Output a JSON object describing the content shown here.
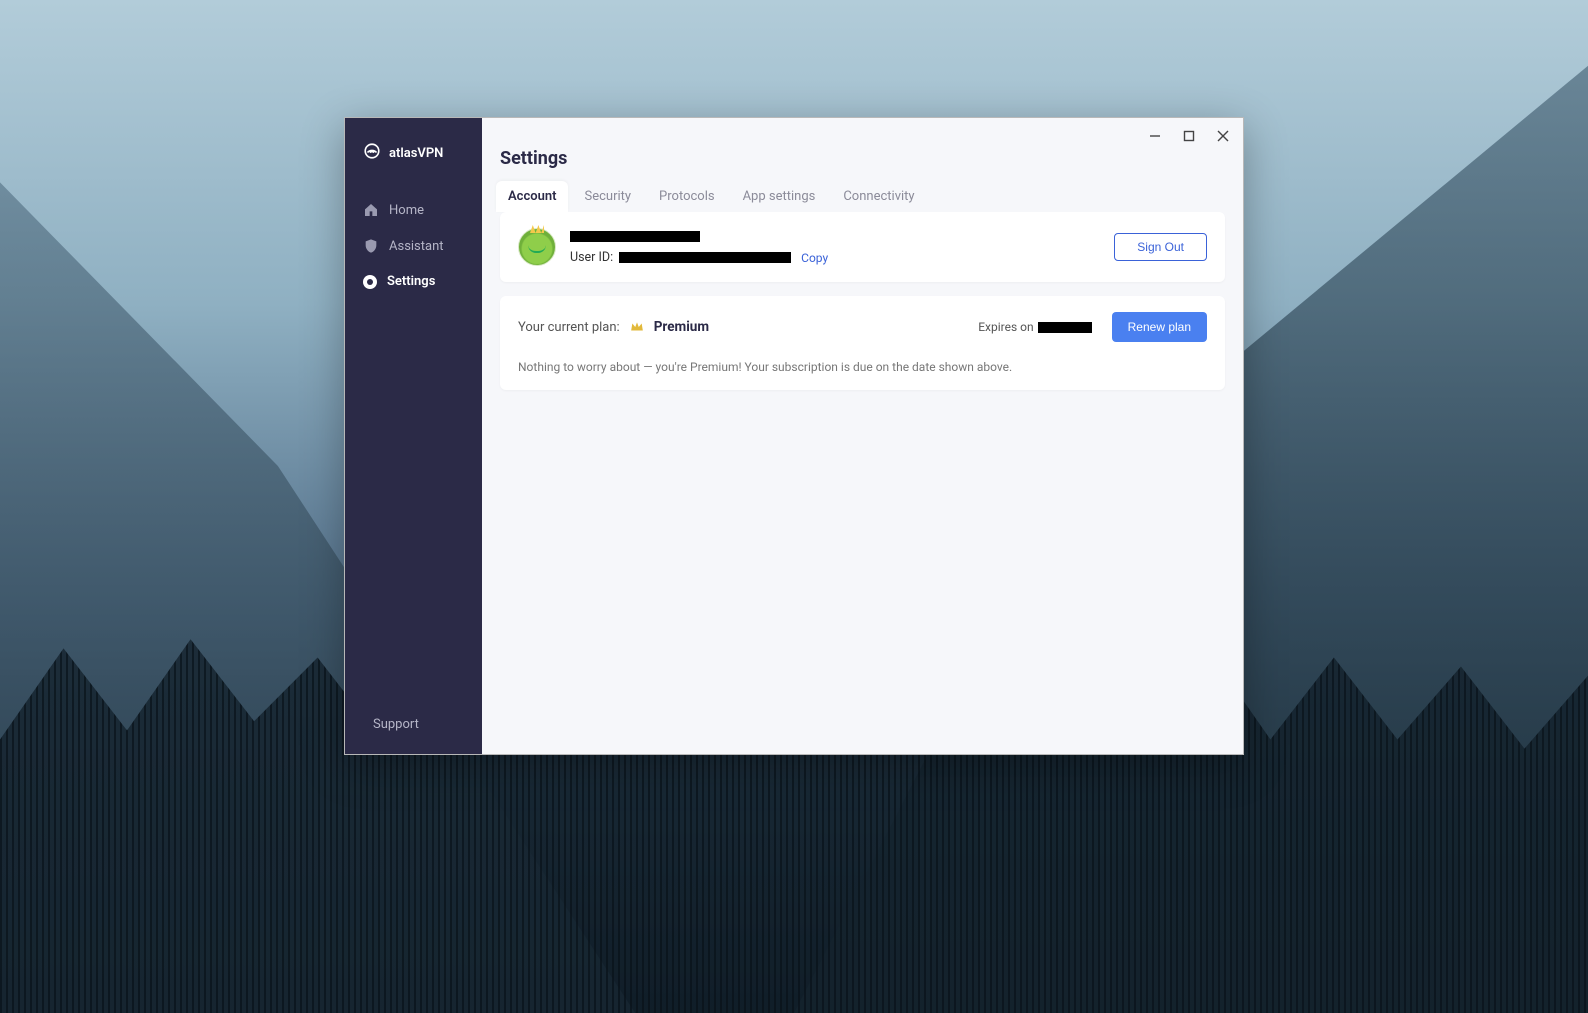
{
  "app": {
    "brand": "atlasVPN"
  },
  "sidebar": {
    "items": [
      {
        "label": "Home"
      },
      {
        "label": "Assistant"
      },
      {
        "label": "Settings"
      }
    ],
    "support": "Support"
  },
  "page": {
    "title": "Settings"
  },
  "tabs": [
    {
      "label": "Account"
    },
    {
      "label": "Security"
    },
    {
      "label": "Protocols"
    },
    {
      "label": "App settings"
    },
    {
      "label": "Connectivity"
    }
  ],
  "account": {
    "user_id_label": "User ID:",
    "copy": "Copy",
    "sign_out": "Sign Out"
  },
  "plan": {
    "current_label": "Your current plan:",
    "name": "Premium",
    "expires_label": "Expires on",
    "renew": "Renew plan",
    "description": "Nothing to worry about — you're Premium! Your subscription is due on the date shown above."
  }
}
